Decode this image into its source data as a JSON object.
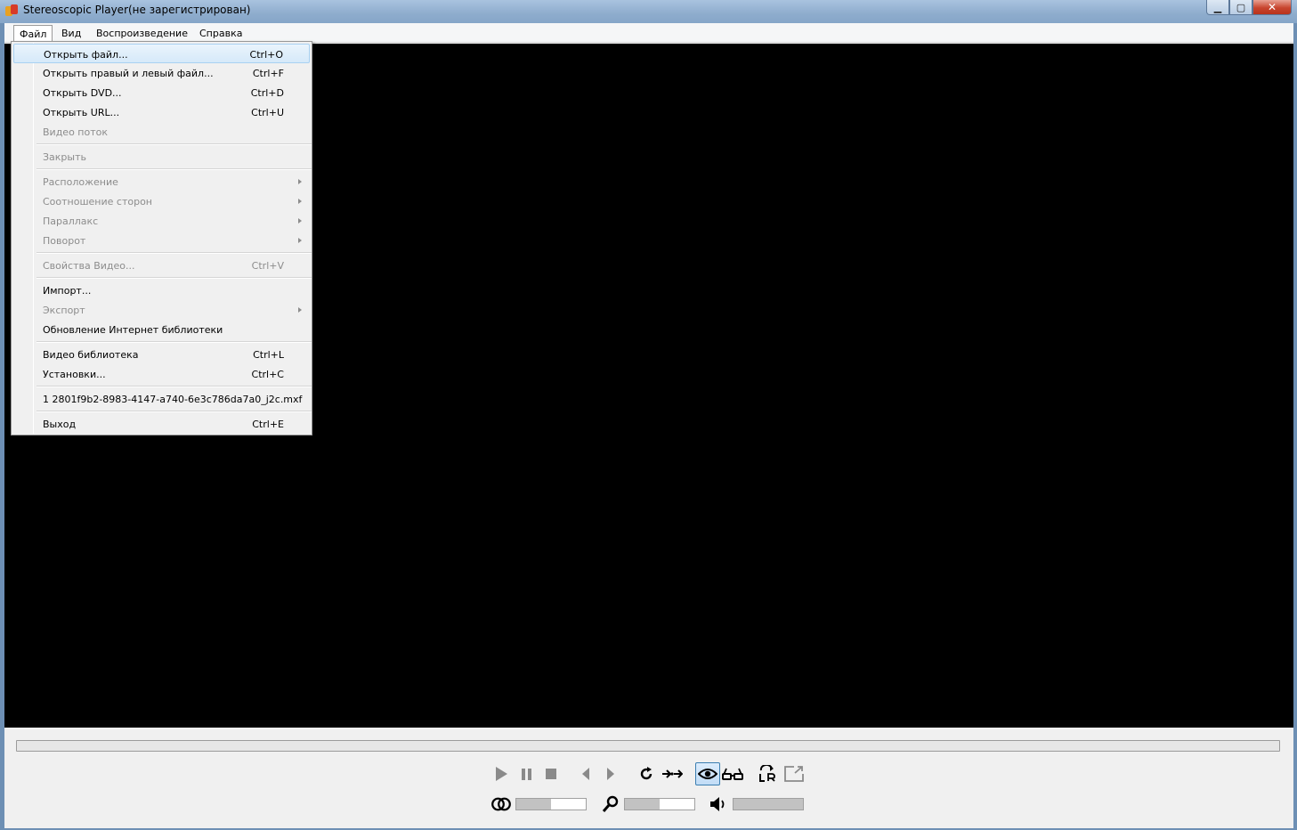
{
  "window": {
    "title": "Stereoscopic Player(не зарегистрирован)"
  },
  "menubar": {
    "items": [
      {
        "label": "Файл"
      },
      {
        "label": "Вид"
      },
      {
        "label": "Воспроизведение"
      },
      {
        "label": "Справка"
      }
    ]
  },
  "file_menu": {
    "items": [
      {
        "label": "Открыть файл...",
        "shortcut": "Ctrl+O"
      },
      {
        "label": "Открыть правый и левый файл...",
        "shortcut": "Ctrl+F"
      },
      {
        "label": "Открыть DVD...",
        "shortcut": "Ctrl+D"
      },
      {
        "label": "Открыть URL...",
        "shortcut": "Ctrl+U"
      },
      {
        "label": "Видео поток",
        "shortcut": ""
      },
      {
        "label": "Закрыть",
        "shortcut": ""
      },
      {
        "label": "Расположение",
        "shortcut": ""
      },
      {
        "label": "Соотношение сторон",
        "shortcut": ""
      },
      {
        "label": "Параллакс",
        "shortcut": ""
      },
      {
        "label": "Поворот",
        "shortcut": ""
      },
      {
        "label": "Свойства Видео...",
        "shortcut": "Ctrl+V"
      },
      {
        "label": "Импорт...",
        "shortcut": ""
      },
      {
        "label": "Экспорт",
        "shortcut": ""
      },
      {
        "label": "Обновление Интернет библиотеки",
        "shortcut": ""
      },
      {
        "label": "Видео библиотека",
        "shortcut": "Ctrl+L"
      },
      {
        "label": "Установки...",
        "shortcut": "Ctrl+C"
      },
      {
        "label": "1 2801f9b2-8983-4147-a740-6e3c786da7a0_j2c.mxf",
        "shortcut": ""
      },
      {
        "label": "Выход",
        "shortcut": "Ctrl+E"
      }
    ]
  },
  "sliders": {
    "parallax_level": 0.5,
    "zoom_level": 0.5,
    "volume_level": 1.0
  },
  "colors": {
    "highlight_bg": "#d6e9f9",
    "highlight_border": "#a8d1f2",
    "disabled_text": "#8c8c8c",
    "video_bg": "#000000"
  }
}
